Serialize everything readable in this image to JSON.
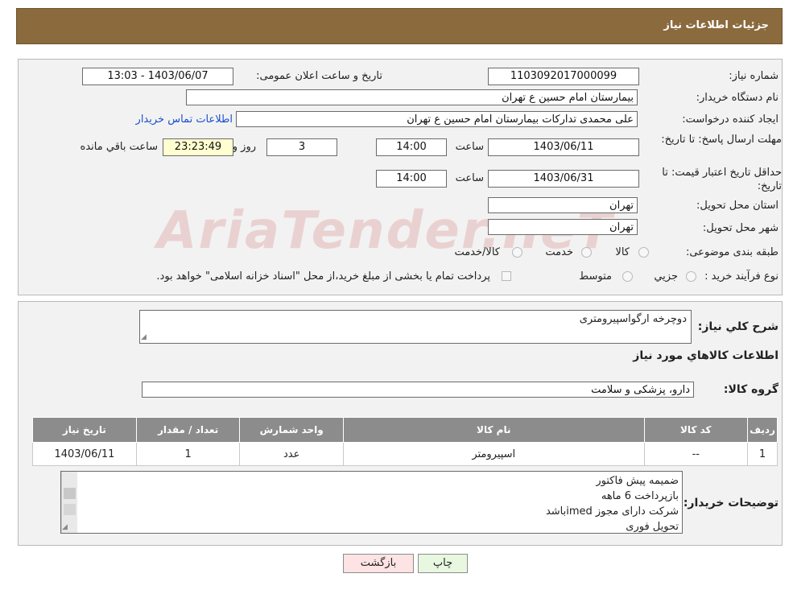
{
  "header": {
    "title": "جزئیات اطلاعات نیاز"
  },
  "form": {
    "need_number": {
      "label": "شماره نیاز:",
      "value": "1103092017000099"
    },
    "announce": {
      "label": "تاریخ و ساعت اعلان عمومی:",
      "value": "1403/06/07 - 13:03"
    },
    "buyer_org": {
      "label": "نام دستگاه خریدار:",
      "value": "بیمارستان امام حسین  ع  تهران"
    },
    "creator": {
      "label": "ایجاد کننده درخواست:",
      "value": "علی محمدی تدارکات بیمارستان امام حسین  ع  تهران",
      "contact_link": "اطلاعات تماس خریدار"
    },
    "reply_deadline": {
      "label": "مهلت ارسال پاسخ: تا تاریخ:",
      "date": "1403/06/11",
      "time_label": "ساعت",
      "time": "14:00",
      "days": "3",
      "days_label": "روز و",
      "remaining": "23:23:49",
      "remaining_label": "ساعت باقي مانده"
    },
    "price_validity": {
      "label": "حداقل تاریخ اعتبار قیمت: تا تاریخ:",
      "date": "1403/06/31",
      "time_label": "ساعت",
      "time": "14:00"
    },
    "delivery_province": {
      "label": "استان محل تحویل:",
      "value": "تهران"
    },
    "delivery_city": {
      "label": "شهر محل تحویل:",
      "value": "تهران"
    },
    "category": {
      "label": "طبقه بندی موضوعی:",
      "options": [
        "کالا",
        "خدمت",
        "کالا/خدمت"
      ]
    },
    "purchase_type": {
      "label": "نوع فرآیند خرید :",
      "options": [
        "جزیي",
        "متوسط"
      ],
      "note": "پرداخت تمام یا بخشی از مبلغ خرید،از محل \"اسناد خزانه اسلامی\" خواهد بود."
    }
  },
  "details": {
    "summary_label": "شرح کلي نیاز:",
    "summary_value": "دوچرخه ارگواسپیرومتری",
    "items_title": "اطلاعات کالاهاي مورد نیاز",
    "group_label": "گروه کالا:",
    "group_value": "دارو، پزشکی و سلامت",
    "table": {
      "headers": [
        "ردیف",
        "کد کالا",
        "نام کالا",
        "واحد شمارش",
        "تعداد / مقدار",
        "تاریخ نیاز"
      ],
      "rows": [
        [
          "1",
          "--",
          "اسپیرومتر",
          "عدد",
          "1",
          "1403/06/11"
        ]
      ]
    },
    "buyer_notes_label": "توضیحات خریدار:",
    "buyer_notes": [
      "ضمیمه پیش فاکتور",
      "بازپرداخت 6 ماهه",
      "شرکت دارای مجوز imedباشد",
      "تحویل فوری"
    ]
  },
  "buttons": {
    "print": "چاپ",
    "back": "بازگشت"
  },
  "colors": {
    "header_bg": "#8b6a3e",
    "table_header_bg": "#8c8c8c",
    "back_button_bg": "#fde3e3",
    "print_button_bg": "#e8f7e0",
    "link": "#1a4fd0",
    "watermark": "#e9c9c9"
  },
  "watermark": "AriaTender.neT"
}
